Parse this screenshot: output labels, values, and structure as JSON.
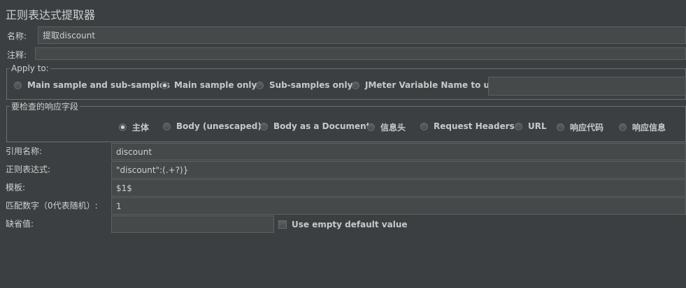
{
  "panel_title": "正则表达式提取器",
  "name_label": "名称:",
  "name_value": "提取discount",
  "comment_label": "注释:",
  "comment_value": "",
  "apply_to": {
    "legend": "Apply to:",
    "options": [
      {
        "label": "Main sample and sub-samples",
        "selected": false
      },
      {
        "label": "Main sample only",
        "selected": true
      },
      {
        "label": "Sub-samples only",
        "selected": false
      },
      {
        "label": "JMeter Variable Name to use",
        "selected": false
      }
    ],
    "variable_name_value": ""
  },
  "response_field": {
    "legend": "要检查的响应字段",
    "options": [
      {
        "label": "主体",
        "selected": true
      },
      {
        "label": "Body (unescaped)",
        "selected": false
      },
      {
        "label": "Body as a Document",
        "selected": false
      },
      {
        "label": "信息头",
        "selected": false
      },
      {
        "label": "Request Headers",
        "selected": false
      },
      {
        "label": "URL",
        "selected": false
      },
      {
        "label": "响应代码",
        "selected": false
      },
      {
        "label": "响应信息",
        "selected": false
      }
    ]
  },
  "reference_name": {
    "label": "引用名称:",
    "value": "discount"
  },
  "regex": {
    "label": "正则表达式:",
    "value": "\"discount\":(.+?)}"
  },
  "template": {
    "label": "模板:",
    "value": "$1$"
  },
  "match_no": {
    "label": "匹配数字（0代表随机）:",
    "value": "1"
  },
  "default_value": {
    "label": "缺省值:",
    "value": ""
  },
  "use_empty_default": {
    "label": "Use empty default value",
    "checked": false
  }
}
